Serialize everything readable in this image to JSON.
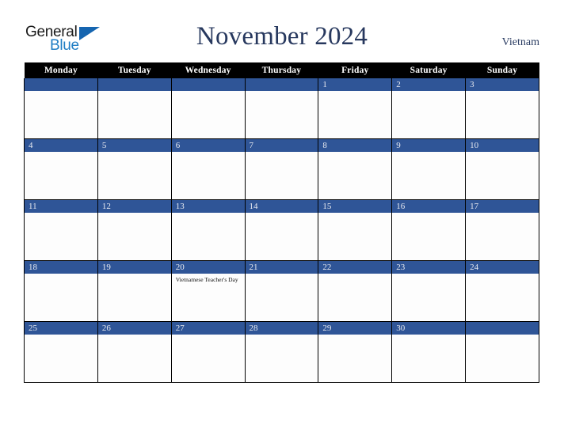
{
  "brand": {
    "name_part1": "General",
    "name_part2": "Blue",
    "triangle_icon": "triangle-icon",
    "colors": {
      "word1": "#1a1a1a",
      "word2": "#1f7dc4",
      "triangle": "#1565b0"
    }
  },
  "header": {
    "title": "November 2024",
    "country": "Vietnam"
  },
  "colors": {
    "title": "#27385e",
    "country": "#2b3d63",
    "header_row_bg": "#000000",
    "header_row_text": "#ffffff",
    "date_bar_bg": "#2f5597",
    "date_bar_text": "#e8eaf0",
    "cell_bg": "#fdfdfd",
    "grid_line": "#000000",
    "event_text": "#111111"
  },
  "calendar": {
    "weekday_headers": [
      "Monday",
      "Tuesday",
      "Wednesday",
      "Thursday",
      "Friday",
      "Saturday",
      "Sunday"
    ],
    "weeks": [
      [
        {
          "day": "",
          "events": []
        },
        {
          "day": "",
          "events": []
        },
        {
          "day": "",
          "events": []
        },
        {
          "day": "",
          "events": []
        },
        {
          "day": "1",
          "events": []
        },
        {
          "day": "2",
          "events": []
        },
        {
          "day": "3",
          "events": []
        }
      ],
      [
        {
          "day": "4",
          "events": []
        },
        {
          "day": "5",
          "events": []
        },
        {
          "day": "6",
          "events": []
        },
        {
          "day": "7",
          "events": []
        },
        {
          "day": "8",
          "events": []
        },
        {
          "day": "9",
          "events": []
        },
        {
          "day": "10",
          "events": []
        }
      ],
      [
        {
          "day": "11",
          "events": []
        },
        {
          "day": "12",
          "events": []
        },
        {
          "day": "13",
          "events": []
        },
        {
          "day": "14",
          "events": []
        },
        {
          "day": "15",
          "events": []
        },
        {
          "day": "16",
          "events": []
        },
        {
          "day": "17",
          "events": []
        }
      ],
      [
        {
          "day": "18",
          "events": []
        },
        {
          "day": "19",
          "events": []
        },
        {
          "day": "20",
          "events": [
            "Vietnamese Teacher's Day"
          ]
        },
        {
          "day": "21",
          "events": []
        },
        {
          "day": "22",
          "events": []
        },
        {
          "day": "23",
          "events": []
        },
        {
          "day": "24",
          "events": []
        }
      ],
      [
        {
          "day": "25",
          "events": []
        },
        {
          "day": "26",
          "events": []
        },
        {
          "day": "27",
          "events": []
        },
        {
          "day": "28",
          "events": []
        },
        {
          "day": "29",
          "events": []
        },
        {
          "day": "30",
          "events": []
        },
        {
          "day": "",
          "events": []
        }
      ]
    ]
  }
}
